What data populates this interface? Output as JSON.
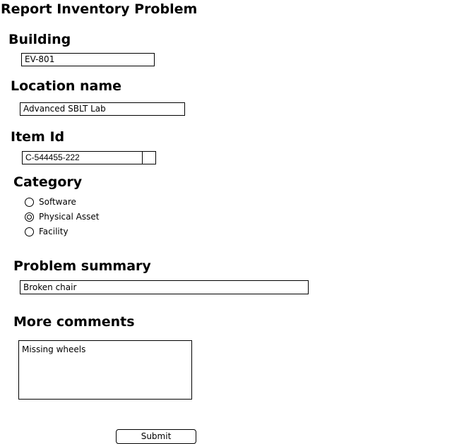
{
  "form": {
    "title": "Report Inventory Problem",
    "building": {
      "label": "Building",
      "value": "EV-801"
    },
    "location": {
      "label": "Location name",
      "value": "Advanced SBLT Lab"
    },
    "item_id": {
      "label": "Item Id",
      "value": "C-544455-222"
    },
    "category": {
      "label": "Category",
      "options": [
        {
          "label": "Software",
          "checked": false
        },
        {
          "label": "Physical Asset",
          "checked": true
        },
        {
          "label": "Facility",
          "checked": false
        }
      ]
    },
    "problem_summary": {
      "label": "Problem summary",
      "value": "Broken chair"
    },
    "more_comments": {
      "label": "More comments",
      "value": "Missing wheels"
    },
    "submit_label": "Submit"
  }
}
